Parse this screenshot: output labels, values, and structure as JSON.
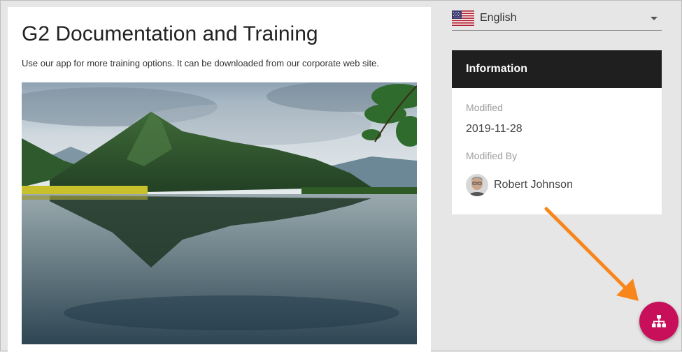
{
  "page": {
    "title": "G2 Documentation and Training",
    "description": "Use our app for more training options. It can be downloaded from our corporate web site."
  },
  "language": {
    "selected": "English",
    "flag_icon": "us-flag-icon"
  },
  "info_panel": {
    "header": "Information",
    "modified_label": "Modified",
    "modified_value": "2019-11-28",
    "modified_by_label": "Modified By",
    "modified_by_value": "Robert Johnson"
  },
  "fab": {
    "icon": "sitemap-icon",
    "color": "#c8105a"
  },
  "annotation": {
    "arrow_color": "#f7861c"
  }
}
